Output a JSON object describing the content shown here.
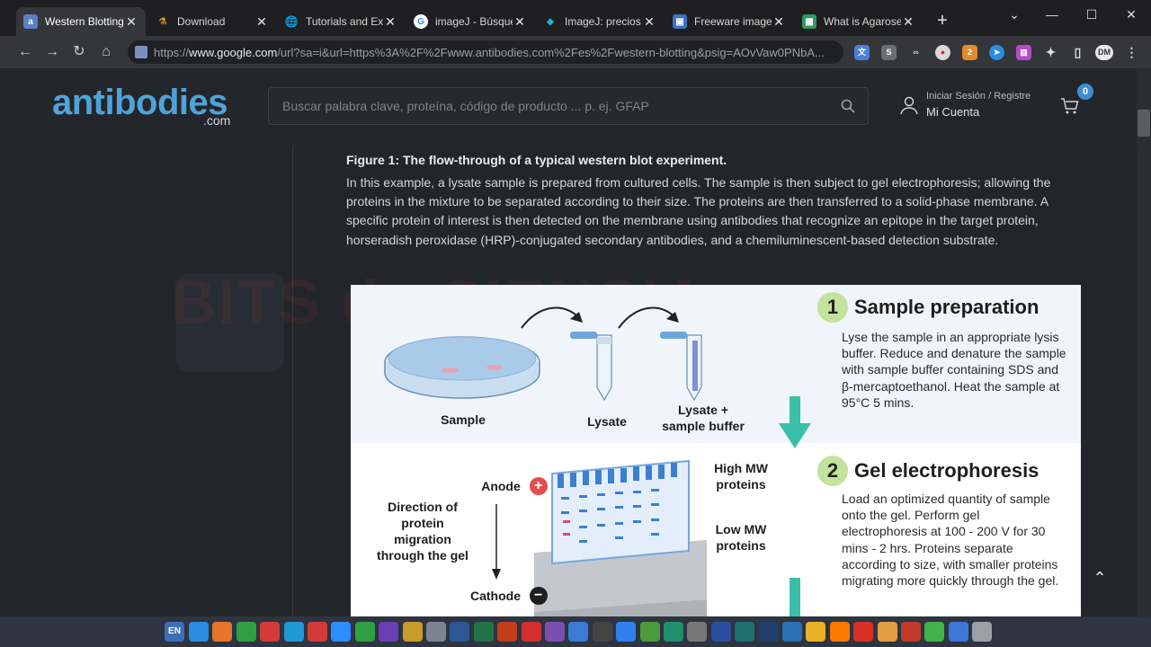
{
  "browser": {
    "tabs": [
      {
        "title": "Western Blotting",
        "favicon": "a",
        "color": "#5c7fc2",
        "active": true
      },
      {
        "title": "Download",
        "favicon": "⚗",
        "color": "#c8921a",
        "active": false
      },
      {
        "title": "Tutorials and Exa",
        "favicon": "🌐",
        "color": "#5f6368",
        "active": false
      },
      {
        "title": "imageJ - Búsque",
        "favicon": "G",
        "color": "#4285f4",
        "active": false
      },
      {
        "title": "ImageJ: precios,",
        "favicon": "◆",
        "color": "#26b3c9",
        "active": false
      },
      {
        "title": "Freeware image",
        "favicon": "▣",
        "color": "#3b72c4",
        "active": false
      },
      {
        "title": "What is Agarose",
        "favicon": "▦",
        "color": "#2f9a5e",
        "active": false
      }
    ],
    "new_tab": "+",
    "url_prefix": "https://",
    "url_host": "www.google.com",
    "url_rest": "/url?sa=i&url=https%3A%2F%2Fwww.antibodies.com%2Fes%2Fwestern-blotting&psig=AOvVaw0PNbA...",
    "ext_badge": "2",
    "profile": "DM"
  },
  "site": {
    "logo": "antibodies",
    "logo_sub": ".com",
    "search_placeholder": "Buscar palabra clave, proteína, código de producto ... p. ej. GFAP",
    "account_line1": "Iniciar Sesión / Registre",
    "account_line2": "Mi Cuenta",
    "cart_count": "0"
  },
  "watermark": "BITS de CIENCIA",
  "article": {
    "figure_title": "Figure 1: The flow-through of a typical western blot experiment.",
    "paragraph": "In this example, a lysate sample is prepared from cultured cells. The sample is then subject to gel electrophoresis; allowing the proteins in the mixture to be separated according to their size. The proteins are then transferred to a solid-phase membrane. A specific protein of interest is then detected on the membrane using antibodies that recognize an epitope in the target protein, horseradish peroxidase (HRP)-conjugated secondary antibodies, and a chemiluminescent-based detection substrate."
  },
  "diagram": {
    "step1": {
      "num": "1",
      "title": "Sample preparation",
      "body": "Lyse the sample in an appropriate lysis buffer. Reduce and denature the sample with sample buffer containing SDS and β-mercaptoethanol. Heat the sample at 95°C 5 mins."
    },
    "step2": {
      "num": "2",
      "title": "Gel electrophoresis",
      "body": "Load an optimized quantity of sample onto the gel. Perform gel electrophoresis at 100 - 200 V for 30 mins - 2 hrs. Proteins separate according to size, with smaller proteins migrating more quickly through the gel."
    },
    "labels": {
      "sample": "Sample",
      "lysate": "Lysate",
      "lysate_buffer_1": "Lysate +",
      "lysate_buffer_2": "sample buffer",
      "anode": "Anode",
      "cathode": "Cathode",
      "high_mw_1": "High MW",
      "high_mw_2": "proteins",
      "low_mw_1": "Low MW",
      "low_mw_2": "proteins",
      "direction_1": "Direction of",
      "direction_2": "protein",
      "direction_3": "migration",
      "direction_4": "through the gel",
      "plus": "+",
      "minus": "−"
    }
  },
  "taskbar": {
    "lang": "EN",
    "apps": [
      "sync-app",
      "firefox",
      "chrome",
      "opera",
      "edge",
      "vivaldi",
      "zoom",
      "camtasia",
      "wps",
      "tool",
      "imagej",
      "word",
      "excel",
      "powerpoint",
      "pdf",
      "winrar",
      "r-studio",
      "devc",
      "vscode",
      "notepad",
      "maze",
      "dll",
      "visio",
      "audition",
      "photoshop",
      "virtualbox",
      "explorer",
      "vlc",
      "gmail",
      "mimo",
      "filezilla",
      "forward",
      "paint",
      "trash"
    ]
  },
  "colors": {
    "accent": "#4fa3d9",
    "step_badge": "#c3e29b",
    "arrow": "#3bbfa8",
    "gel": "#7aa6e0"
  }
}
